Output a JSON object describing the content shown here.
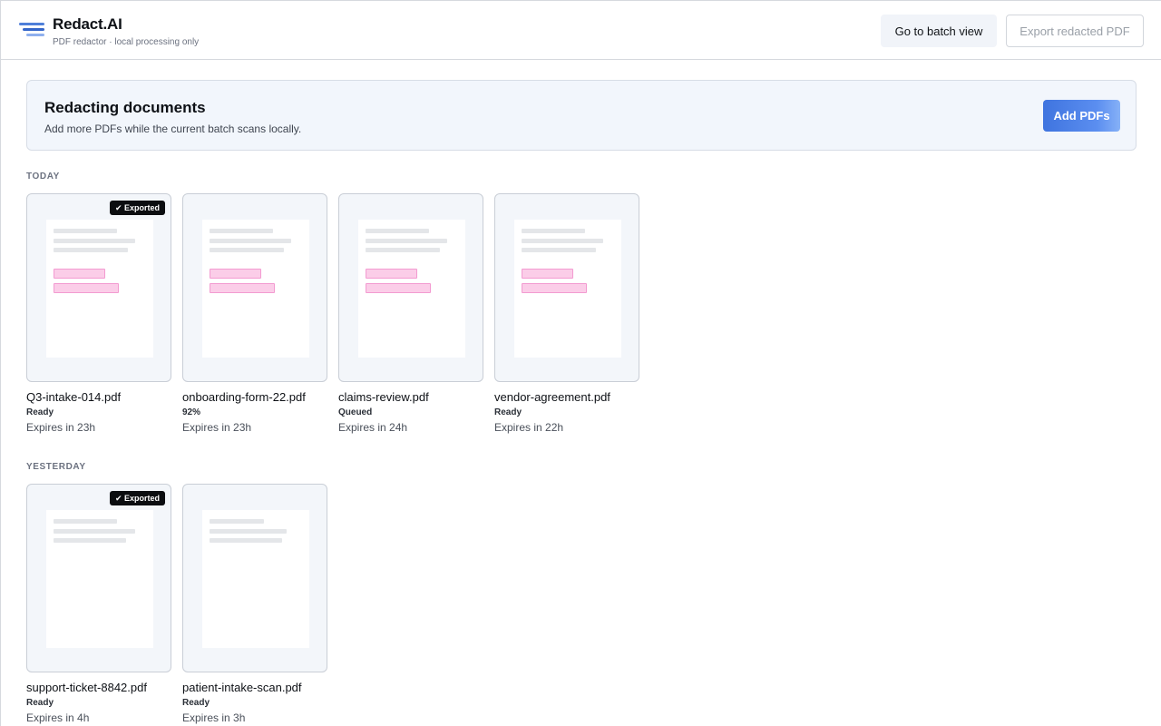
{
  "header": {
    "title": "Redact.AI",
    "subtitle": "PDF redactor · local processing only",
    "batch_button": "Go to batch view",
    "export_button": "Export redacted PDF"
  },
  "banner": {
    "title": "Redacting documents",
    "text": "Add more PDFs while the current batch scans locally.",
    "add_button": "Add PDFs"
  },
  "badge_label": "✔ Exported",
  "sections": [
    {
      "label": "TODAY",
      "files": [
        {
          "name": "Q3-intake-014.pdf",
          "status": "Ready",
          "expires": "Expires in 23h",
          "exported": true,
          "redactions": true
        },
        {
          "name": "onboarding-form-22.pdf",
          "status": "92%",
          "expires": "Expires in 23h",
          "exported": false,
          "redactions": true
        },
        {
          "name": "claims-review.pdf",
          "status": "Queued",
          "expires": "Expires in 24h",
          "exported": false,
          "redactions": true
        },
        {
          "name": "vendor-agreement.pdf",
          "status": "Ready",
          "expires": "Expires in 22h",
          "exported": false,
          "redactions": true
        }
      ]
    },
    {
      "label": "YESTERDAY",
      "files": [
        {
          "name": "support-ticket-8842.pdf",
          "status": "Ready",
          "expires": "Expires in 4h",
          "exported": true,
          "redactions": false
        },
        {
          "name": "patient-intake-scan.pdf",
          "status": "Ready",
          "expires": "Expires in 3h",
          "exported": false,
          "redactions": false
        }
      ]
    }
  ],
  "colors": {
    "accent": "#3f74df",
    "redaction_fill": "#fbcde8",
    "redaction_border": "#f39bd1",
    "badge_bg": "#0b0d10"
  }
}
